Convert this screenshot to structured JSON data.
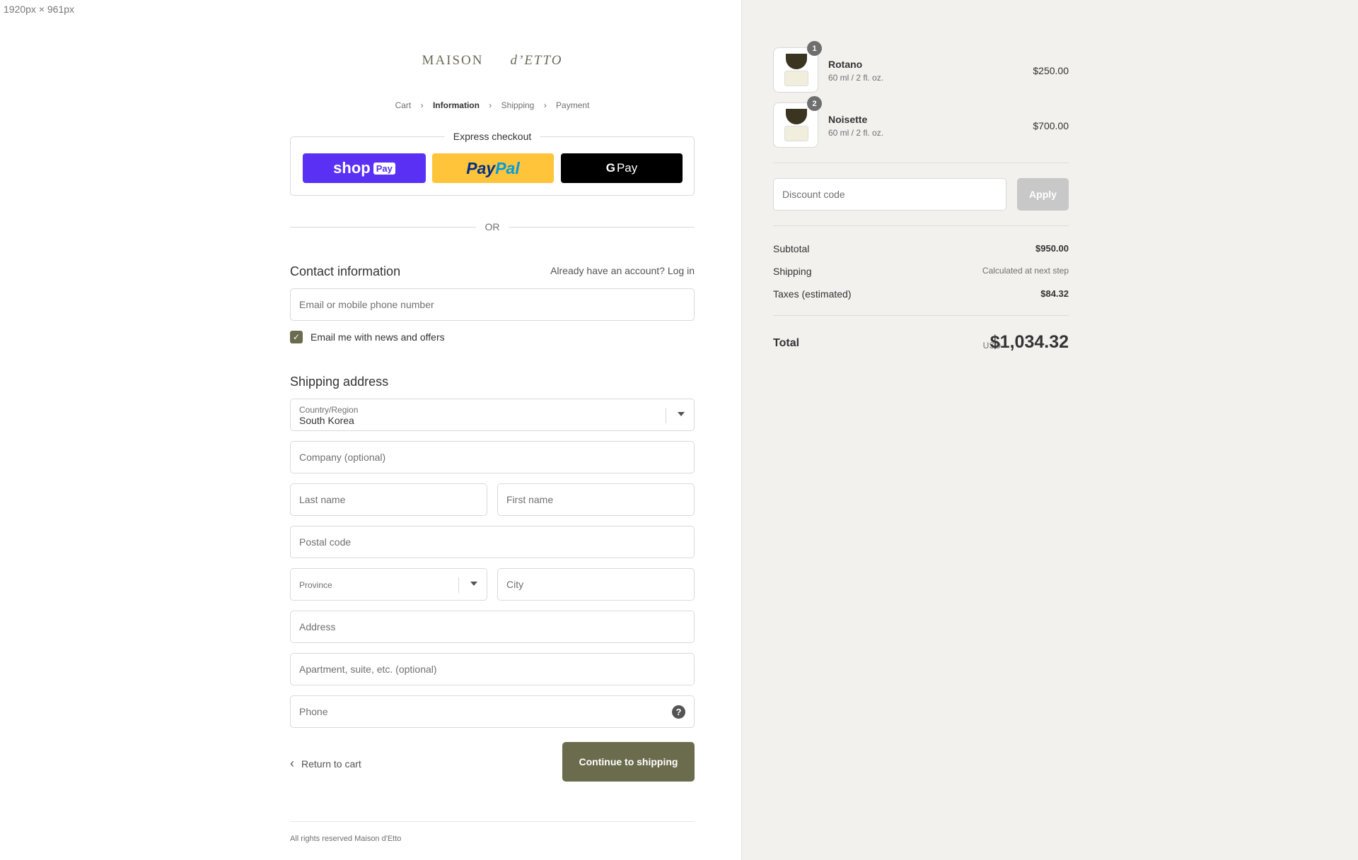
{
  "page_size_label": "1920px × 961px",
  "brand": {
    "part1": "MAISON",
    "part2": "d’ETTO"
  },
  "breadcrumb": [
    {
      "label": "Cart"
    },
    {
      "label": "Information"
    },
    {
      "label": "Shipping"
    },
    {
      "label": "Payment"
    }
  ],
  "express": {
    "title": "Express checkout",
    "shoppay": {
      "shop": "shop",
      "pay": "Pay"
    },
    "paypal": {
      "part1": "Pay",
      "part2": "Pal"
    },
    "gpay": {
      "g": "G",
      "pay": "Pay"
    }
  },
  "or_label": "OR",
  "contact": {
    "title": "Contact information",
    "account_prompt": "Already have an account?",
    "login_label": "Log in",
    "email_placeholder": "Email or mobile phone number",
    "newsletter_label": "Email me with news and offers",
    "newsletter_checked": true
  },
  "shipping": {
    "title": "Shipping address",
    "country_label": "Country/Region",
    "country_value": "South Korea",
    "company_placeholder": "Company (optional)",
    "last_name_placeholder": "Last name",
    "first_name_placeholder": "First name",
    "postal_placeholder": "Postal code",
    "province_label": "Province",
    "city_placeholder": "City",
    "address_placeholder": "Address",
    "apartment_placeholder": "Apartment, suite, etc. (optional)",
    "phone_placeholder": "Phone",
    "help_icon": "?"
  },
  "actions": {
    "return_label": "Return to cart",
    "continue_label": "Continue to shipping"
  },
  "footer": {
    "text": "All rights reserved Maison d'Etto"
  },
  "order": {
    "items": [
      {
        "name": "Rotano",
        "variant": "60 ml / 2 fl. oz.",
        "price": "$250.00",
        "quantity": "1"
      },
      {
        "name": "Noisette",
        "variant": "60 ml / 2 fl. oz.",
        "price": "$700.00",
        "quantity": "2"
      }
    ],
    "discount_placeholder": "Discount code",
    "apply_label": "Apply",
    "subtotal_label": "Subtotal",
    "subtotal_value": "$950.00",
    "shipping_label": "Shipping",
    "shipping_value": "Calculated at next step",
    "taxes_label": "Taxes (estimated)",
    "taxes_value": "$84.32",
    "total_label": "Total",
    "currency": "USD",
    "total_value": "$1,034.32"
  },
  "colors": {
    "accent": "#6b6c4e",
    "shoppay": "#5a31f4",
    "paypal": "#ffc439",
    "summary_bg": "#f2f1ee"
  }
}
